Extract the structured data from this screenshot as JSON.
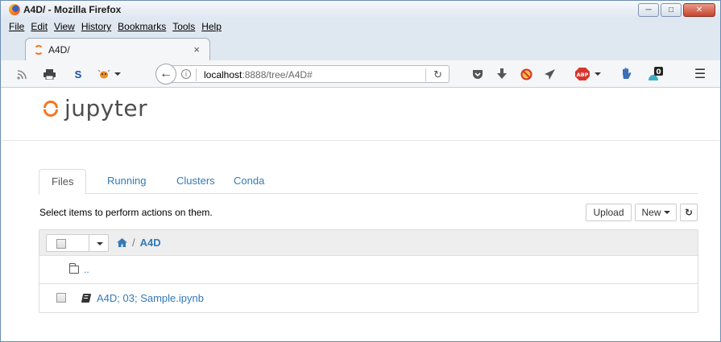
{
  "window": {
    "title": "A4D/ - Mozilla Firefox",
    "controls": [
      "minimize",
      "maximize",
      "close"
    ]
  },
  "menubar": {
    "items": [
      {
        "label": "File"
      },
      {
        "label": "Edit"
      },
      {
        "label": "View"
      },
      {
        "label": "History"
      },
      {
        "label": "Bookmarks"
      },
      {
        "label": "Tools"
      },
      {
        "label": "Help"
      }
    ]
  },
  "browser_tab": {
    "label": "A4D/",
    "close": "×"
  },
  "toolbar": {
    "icons": [
      "rss-icon",
      "print-icon",
      "s-extension-icon",
      "bug-extension-icon"
    ],
    "right_icons": [
      "pocket-icon",
      "download-icon",
      "blocked-icon",
      "send-icon",
      "adblock-icon",
      "hand-icon",
      "notification-icon",
      "hamburger-menu-icon"
    ],
    "notification_count": "0",
    "adblock_label": "ABP"
  },
  "urlbar": {
    "host": "localhost",
    "rest": ":8888/tree/A4D#",
    "info": "i",
    "reload": "C"
  },
  "jupyter": {
    "logo_text": "jupyter"
  },
  "tabs": [
    {
      "label": "Files",
      "active": true
    },
    {
      "label": "Running",
      "active": false
    },
    {
      "label": "Clusters",
      "active": false
    },
    {
      "label": "Conda",
      "active": false
    }
  ],
  "hint": "Select items to perform actions on them.",
  "buttons": {
    "upload": "Upload",
    "new": "New",
    "refresh": "↻"
  },
  "breadcrumb": {
    "home_icon": "home-icon",
    "separator": "/",
    "folder": "A4D"
  },
  "files": {
    "updir": "..",
    "items": [
      {
        "name": "A4D; 03; Sample.ipynb",
        "type": "notebook"
      }
    ]
  },
  "colors": {
    "link": "#337ab7",
    "jupyter_orange": "#f37626",
    "chrome_bg": "#dfe7f1"
  }
}
